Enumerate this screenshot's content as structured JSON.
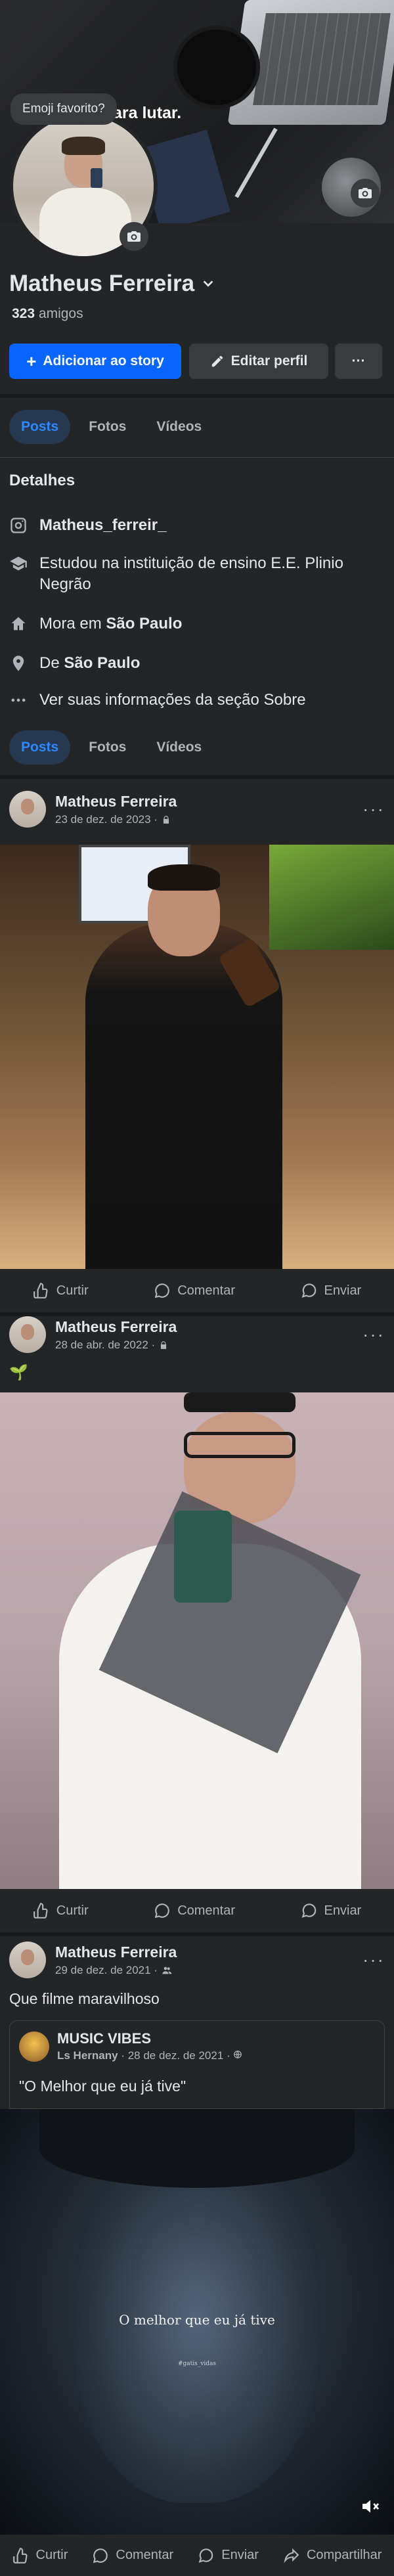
{
  "cover": {
    "slogan": "ara lutar.",
    "emoji_prompt": "Emoji favorito?"
  },
  "profile": {
    "name": "Matheus Ferreira",
    "friends_count": "323",
    "friends_label": "amigos"
  },
  "buttons": {
    "add_story": "Adicionar ao story",
    "edit_profile": "Editar perfil",
    "more": "···"
  },
  "tabs": [
    "Posts",
    "Fotos",
    "Vídeos"
  ],
  "details": {
    "title": "Detalhes",
    "instagram": "Matheus_ferreir_",
    "studied": "Estudou na instituição de ensino E.E. Plinio Negrão",
    "lives_prefix": "Mora em ",
    "lives_city": "São Paulo",
    "from_prefix": "De ",
    "from_city": "São Paulo",
    "about": "Ver suas informações da seção Sobre"
  },
  "posts": [
    {
      "author": "Matheus Ferreira",
      "date": "23 de dez. de 2023 · ",
      "privacy": "lock-icon"
    },
    {
      "author": "Matheus Ferreira",
      "date": "28 de abr. de 2022 · ",
      "privacy": "lock-icon",
      "text": "🌱"
    },
    {
      "author": "Matheus Ferreira",
      "date": "29 de dez. de 2021 · ",
      "privacy": "friends-icon",
      "text": "Que filme maravilhoso",
      "shared": {
        "page": "MUSIC VIBES",
        "author": "Ls Hernany",
        "date": "28 de dez. de 2021 · ",
        "quote": "\"O Melhor que eu já tive\""
      },
      "video_overlay": "O melhor que eu já tive",
      "video_watermark": "#gatis_vidas"
    }
  ],
  "actions": {
    "like": "Curtir",
    "comment": "Comentar",
    "send": "Enviar",
    "share": "Compartilhar"
  },
  "colors": {
    "background": "#242526",
    "primary": "#0866ff",
    "tab_active_bg": "#263951",
    "tab_active_text": "#2d88ff"
  }
}
